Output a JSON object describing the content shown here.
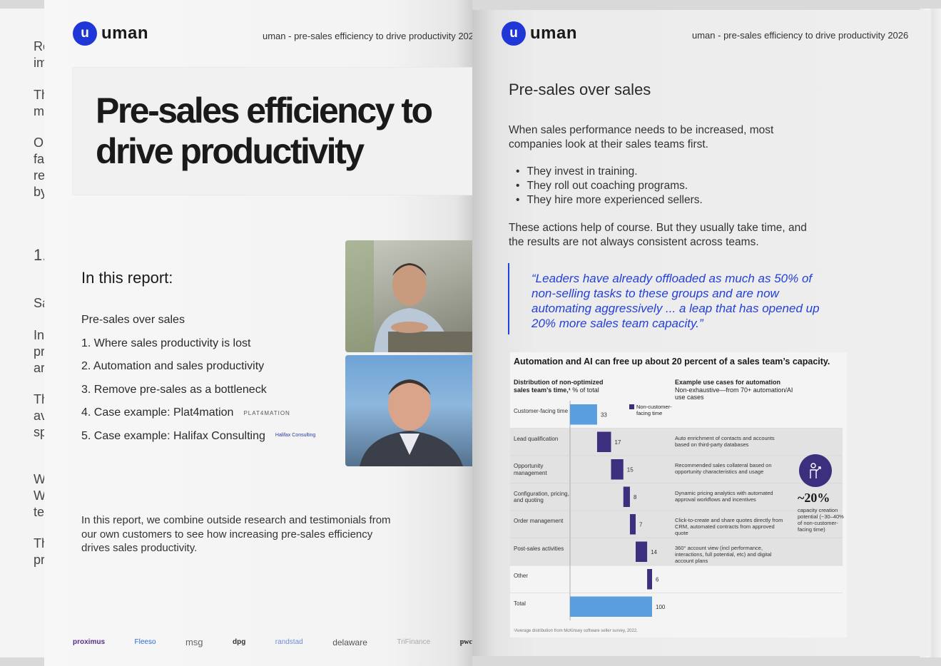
{
  "background_page": {
    "lines": [
      "Re",
      "im",
      "Th",
      "m",
      "O",
      "fa",
      "re",
      "by",
      "1.",
      "Sa",
      "In",
      "pr",
      "ar",
      "Th",
      "av",
      "sp",
      "W",
      "W",
      "te",
      "Th",
      "pr"
    ]
  },
  "brand": {
    "mark": "u",
    "name": "uman",
    "accent": "#1f37d6"
  },
  "left_page": {
    "running_header": "uman - pre-sales efficiency to drive productivity 202",
    "title": "Pre-sales efficiency to drive productivity",
    "report_heading": "In this report:",
    "toc": [
      "Pre-sales over sales",
      "1. Where sales productivity is lost",
      "2. Automation and sales productivity",
      "3. Remove pre-sales as a bottleneck",
      "4. Case example: Plat4mation",
      "5. Case example: Halifax Consulting"
    ],
    "toc_logos": {
      "plat4mation": "PLAT4MATION",
      "halifax": "Halifax Consulting"
    },
    "intro": "In this report, we combine outside research and testimonials from our own customers to see how increasing pre-sales efficiency drives sales productivity.",
    "partners": [
      "proximus",
      "Fleeso",
      "msg",
      "dpg",
      "randstad",
      "delaware",
      "TriFinance",
      "pwc"
    ]
  },
  "right_page": {
    "running_header": "uman - pre-sales efficiency to drive productivity 2026",
    "section_title": "Pre-sales over sales",
    "para1": "When sales performance needs to be increased, most companies look at their sales teams first.",
    "bullets": [
      "They invest in training.",
      "They roll out coaching programs.",
      "They hire more experienced sellers."
    ],
    "para2": "These actions help of course. But they usually take time, and the results are not always consistent across teams.",
    "quote": "“Leaders have already offloaded as much as 50% of non-selling tasks to these groups and are now automating aggressively ... a leap that has opened up 20% more sales team capacity.”",
    "quote_color": "#2340d8"
  },
  "chart_data": {
    "type": "bar",
    "title": "Automation and AI can free up  about 20 percent of a sales team’s capacity.",
    "left_heading_bold": "Distribution of non-optimized sales team’s time,¹",
    "left_heading_unit": "% of total",
    "right_heading_bold": "Example use cases for automation",
    "right_heading_sub": "Non-exhaustive—from 70+ automation/AI use cases",
    "legend": "Non-customer-facing time",
    "categories": [
      "Customer-facing time",
      "Lead qualification",
      "Opportunity management",
      "Configuration, pricing, and quoting",
      "Order management",
      "Post-sales activities",
      "Other",
      "Total"
    ],
    "values": [
      33,
      17,
      15,
      8,
      7,
      14,
      6,
      100
    ],
    "kind": [
      "customer",
      "non",
      "non",
      "non",
      "non",
      "non",
      "non",
      "total"
    ],
    "use_cases": [
      "",
      "Auto enrichment of contacts and accounts based on third-party databases",
      "Recommended sales collateral based on opportunity characteristics and usage",
      "Dynamic pricing analytics with automated approval workflows and incentives",
      "Click-to-create and share quotes directly from CRM, automated contracts from approved quote",
      "360° account view (incl performance, interactions, full potential, etc) and digital account plans",
      "",
      ""
    ],
    "highlight": "~20%",
    "highlight_note": "capacity creation potential (~30–40% of non-customer-facing time)",
    "footnote": "¹Average distribution from McKinsey software seller survey, 2022.",
    "colors": {
      "customer": "#5a9ee0",
      "non": "#3b2f7e",
      "band": "#e2e2e2"
    }
  }
}
